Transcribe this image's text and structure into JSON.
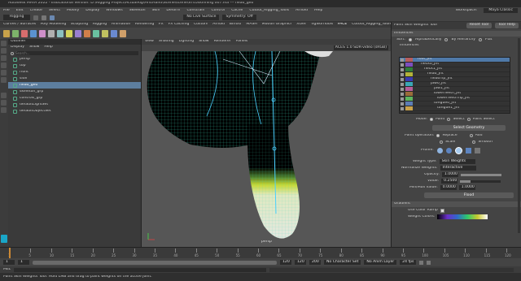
{
  "window": {
    "title": "Autodesk MAYA 2022 - Educational Version: D:\\Rigging Project\\ActualRig\\FirstHand\\Scene\\scene\\ST05skinning 007.ma --- head_geo"
  },
  "menubar": {
    "items": [
      "File",
      "Edit",
      "Create",
      "Select",
      "Modify",
      "Display",
      "Windows",
      "Skeleton",
      "Skin",
      "Deform",
      "Constrain",
      "Control",
      "Cache",
      "Cutout_Rigging_Tools",
      "Arnold",
      "Help"
    ],
    "workspace_label": "Workspace:",
    "workspace_value": "Maya Classic"
  },
  "statusline": {
    "mode": "Rigging",
    "no_live_surface": "No Live Surface",
    "symmetry": "Symmetry: Off"
  },
  "shelf": {
    "tabs": [
      "Curves / Surfaces",
      "Poly Modeling",
      "Sculpting",
      "Rigging",
      "Animation",
      "Rendering",
      "FX",
      "FX Caching",
      "Custom",
      "Arnold",
      "Bifrost",
      "MASH",
      "Motion Graphics",
      "XGen",
      "ngSkinTools",
      "FACE",
      "Cutout_Rigging_Tools"
    ],
    "icon_colors": [
      "#c9a24a",
      "#7db36a",
      "#d86d6d",
      "#5a92cf",
      "#cf8fc9",
      "#b0b0b0",
      "#8bc0c0",
      "#d4d45a",
      "#9a7fd0",
      "#d07f4a",
      "#6ac0a0",
      "#c0c060",
      "#6a8ad0",
      "#d0a06a"
    ]
  },
  "outliner": {
    "title": "Outliner",
    "menu": [
      "Display",
      "Show",
      "Help"
    ],
    "search_placeholder": "Search...",
    "items": [
      {
        "label": "persp",
        "type": "camera"
      },
      {
        "label": "top",
        "type": "camera"
      },
      {
        "label": "front",
        "type": "camera"
      },
      {
        "label": "side",
        "type": "camera"
      },
      {
        "label": "head_geo",
        "type": "mesh",
        "selected": true
      },
      {
        "label": "skeleton_grp",
        "type": "group"
      },
      {
        "label": "controls_grp",
        "type": "group"
      },
      {
        "label": "defaultLightSet",
        "type": "set"
      },
      {
        "label": "defaultObjectSet",
        "type": "set"
      }
    ]
  },
  "viewport": {
    "menu": [
      "View",
      "Shading",
      "Lighting",
      "Show",
      "Renderer",
      "Panels"
    ],
    "camera_label": "persp",
    "color_space": "ACES 1.0 SDR-video (sRGB)"
  },
  "rightpanel": {
    "title": "Paint Skin Weights Tool",
    "reset_label": "Reset Tool",
    "help_label": "Tool Help",
    "influences_section": "Influences",
    "sort_label": "Sort:",
    "sort_options": [
      "Alphabetically",
      "By Hierarchy",
      "Flat"
    ],
    "influences_label": "Influences",
    "joints": [
      {
        "name": "root_jnt",
        "color": "#b55d5d",
        "indent": 0
      },
      {
        "name": "neck0_jnt",
        "color": "#7c4fbf",
        "indent": 1
      },
      {
        "name": "neck1_jnt",
        "color": "#2f7d3a",
        "indent": 2
      },
      {
        "name": "head_jnt",
        "color": "#b3b33a",
        "indent": 3
      },
      {
        "name": "headTip_jnt",
        "color": "#3a3ab0",
        "indent": 4
      },
      {
        "name": "jaw0_jnt",
        "color": "#3aa7b5",
        "indent": 4
      },
      {
        "name": "jaw1_jnt",
        "color": "#b55d9a",
        "indent": 5
      },
      {
        "name": "lowerTeeth_jnt",
        "color": "#9a6d3a",
        "indent": 5
      },
      {
        "name": "lowerTeethTip_jnt",
        "color": "#5db55d",
        "indent": 6
      },
      {
        "name": "tongue0_jnt",
        "color": "#5d7db5",
        "indent": 5
      },
      {
        "name": "tongue1_jnt",
        "color": "#c9a24a",
        "indent": 6
      }
    ],
    "mode_label": "Mode:",
    "modes": [
      "Paint",
      "Select",
      "Paint Select"
    ],
    "select_geometry": "Select Geometry",
    "paint_ops_label": "Paint operation:",
    "paint_ops": [
      "Replace",
      "Add",
      "Scale",
      "Smooth"
    ],
    "profile_label": "Profile:",
    "weight_type_label": "Weight Type:",
    "weight_type": "Skin Weights",
    "normalize_label": "Normalize Weights:",
    "normalize_value": "Interactive",
    "opacity_label": "Opacity:",
    "opacity": "1.0000",
    "value_label": "Value:",
    "value": "0.2500",
    "minmax_label": "Min/Max value:",
    "min": "0.0000",
    "max": "1.0000",
    "flood": "Flood",
    "gradient_section": "Gradient",
    "use_color_ramp": "Use Color Ramp",
    "weight_colors_label": "Weight Colors:"
  },
  "timeslider": {
    "ticks": [
      "1",
      "5",
      "10",
      "15",
      "20",
      "25",
      "30",
      "35",
      "40",
      "45",
      "50",
      "55",
      "60",
      "65",
      "70",
      "75",
      "80",
      "85",
      "90",
      "95",
      "100",
      "105",
      "110",
      "115",
      "120"
    ],
    "current_frame": "1"
  },
  "rangebar": {
    "start": "1",
    "start2": "1",
    "end": "120",
    "end2": "120",
    "end3": "200",
    "character_set": "No Character Set",
    "anim_layer": "No Anim Layer",
    "fps": "24 fps"
  },
  "cmdline": {
    "label": "MEL"
  },
  "helpline": {
    "text": "Paint Skin Weights Tool: Hold LMB and drag to paint weights on the active joint."
  },
  "chart_data": null
}
